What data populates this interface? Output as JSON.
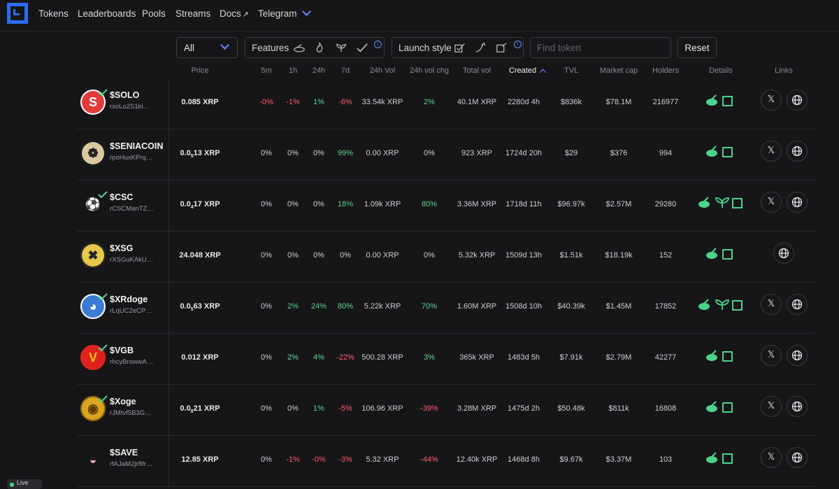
{
  "nav": {
    "items": [
      "Tokens",
      "Leaderboards",
      "Pools",
      "Streams",
      "Docs",
      "Telegram"
    ]
  },
  "filters": {
    "category": "All",
    "features_label": "Features",
    "launch_label": "Launch style",
    "search_placeholder": "Find token",
    "reset_label": "Reset",
    "info_icon": "i"
  },
  "columns": [
    "Price",
    "5m",
    "1h",
    "24h",
    "7d",
    "24h Vol",
    "24h vol chg",
    "Total vol",
    "Created",
    "TVL",
    "Market cap",
    "Holders",
    "Details",
    "Links"
  ],
  "colors": {
    "accent": "#2d6cf0",
    "positive": "#5fd38f",
    "negative": "#ff5c6c",
    "feature": "#4cd38a"
  },
  "rows": [
    {
      "name": "$SOLO",
      "addr": "rsoLo2S1ki…",
      "price": "0.085 XRP",
      "m5": "-0%",
      "h1": "-1%",
      "h24": "1%",
      "d7": "-6%",
      "vol24": "33.54k XRP",
      "volchg": "2%",
      "total": "40.1M XRP",
      "created": "2280d 4h",
      "tvl": "$836k",
      "mcap": "$78.1M",
      "holders": "216977",
      "verified": true
    },
    {
      "name": "$SENIACOIN",
      "addr": "rpoHuxKPrq…",
      "price_pre": "0.0",
      "price_sub": "5",
      "price_post": "13 XRP",
      "m5": "0%",
      "h1": "0%",
      "h24": "0%",
      "d7": "99%",
      "vol24": "0.00 XRP",
      "volchg": "0%",
      "total": "923 XRP",
      "created": "1724d 20h",
      "tvl": "$29",
      "mcap": "$376",
      "holders": "994",
      "verified": false
    },
    {
      "name": "$CSC",
      "addr": "rCSCManTZ…",
      "price_pre": "0.0",
      "price_sub": "4",
      "price_post": "17 XRP",
      "m5": "0%",
      "h1": "0%",
      "h24": "0%",
      "d7": "18%",
      "vol24": "1.09k XRP",
      "volchg": "80%",
      "total": "3.36M XRP",
      "created": "1718d 11h",
      "tvl": "$96.97k",
      "mcap": "$2.57M",
      "holders": "29280",
      "verified": true
    },
    {
      "name": "$XSG",
      "addr": "rXSGuKAkU…",
      "price": "24.048 XRP",
      "m5": "0%",
      "h1": "0%",
      "h24": "0%",
      "d7": "0%",
      "vol24": "0.00 XRP",
      "volchg": "0%",
      "total": "5.32k XRP",
      "created": "1509d 13h",
      "tvl": "$1.51k",
      "mcap": "$18.19k",
      "holders": "152",
      "verified": false
    },
    {
      "name": "$XRdoge",
      "addr": "rLqUC2eCP…",
      "price_pre": "0.0",
      "price_sub": "5",
      "price_post": "63 XRP",
      "m5": "0%",
      "h1": "2%",
      "h24": "24%",
      "d7": "80%",
      "vol24": "5.22k XRP",
      "volchg": "70%",
      "total": "1.60M XRP",
      "created": "1508d 10h",
      "tvl": "$40.39k",
      "mcap": "$1.45M",
      "holders": "17852",
      "verified": true
    },
    {
      "name": "$VGB",
      "addr": "rhcyBrowwA…",
      "price": "0.012 XRP",
      "m5": "0%",
      "h1": "2%",
      "h24": "4%",
      "d7": "-22%",
      "vol24": "500.28 XRP",
      "volchg": "3%",
      "total": "365k XRP",
      "created": "1483d 5h",
      "tvl": "$7.91k",
      "mcap": "$2.79M",
      "holders": "42277",
      "verified": true
    },
    {
      "name": "$Xoge",
      "addr": "rJMtvf5B3G…",
      "price_pre": "0.0",
      "price_sub": "8",
      "price_post": "21 XRP",
      "m5": "0%",
      "h1": "0%",
      "h24": "1%",
      "d7": "-5%",
      "vol24": "106.96 XRP",
      "volchg": "-39%",
      "total": "3.28M XRP",
      "created": "1475d 2h",
      "tvl": "$50.48k",
      "mcap": "$811k",
      "holders": "16808",
      "verified": true
    },
    {
      "name": "$SAVE",
      "addr": "rfAJaM2jr8fr…",
      "price": "12.85 XRP",
      "m5": "0%",
      "h1": "-1%",
      "h24": "-0%",
      "d7": "-3%",
      "vol24": "5.32 XRP",
      "volchg": "-44%",
      "total": "12.40k XRP",
      "created": "1468d 8h",
      "tvl": "$9.67k",
      "mcap": "$3.37M",
      "holders": "103",
      "verified": false
    }
  ],
  "status_text": "Live"
}
